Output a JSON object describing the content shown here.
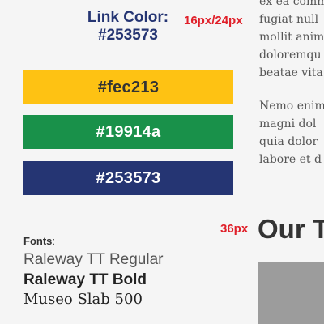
{
  "link_color": {
    "label": "Link Color:",
    "value": "#253573",
    "size_note": "16px/24px"
  },
  "swatches": [
    {
      "label": "#fec213",
      "bg": "#fec213",
      "fg": "#333333"
    },
    {
      "label": "#19914a",
      "bg": "#19914a",
      "fg": "#ffffff"
    },
    {
      "label": "#253573",
      "bg": "#253573",
      "fg": "#ffffff"
    }
  ],
  "fonts": {
    "label": "Fonts",
    "colon": ":",
    "items": [
      "Raleway TT Regular",
      "Raleway TT Bold",
      "Museo Slab 500"
    ]
  },
  "body_text": {
    "paragraph1": [
      "ex ea comm",
      "fugiat null",
      "mollit anim",
      "doloremqu",
      "beatae vita"
    ],
    "paragraph2": [
      "Nemo enim",
      "magni dol",
      "quia dolor",
      "labore et d"
    ]
  },
  "heading": {
    "size_note": "36px",
    "text": "Our T"
  },
  "colors": {
    "note_red": "#e0202a",
    "link": "#253573",
    "placeholder_gray": "#9c9c9c"
  }
}
